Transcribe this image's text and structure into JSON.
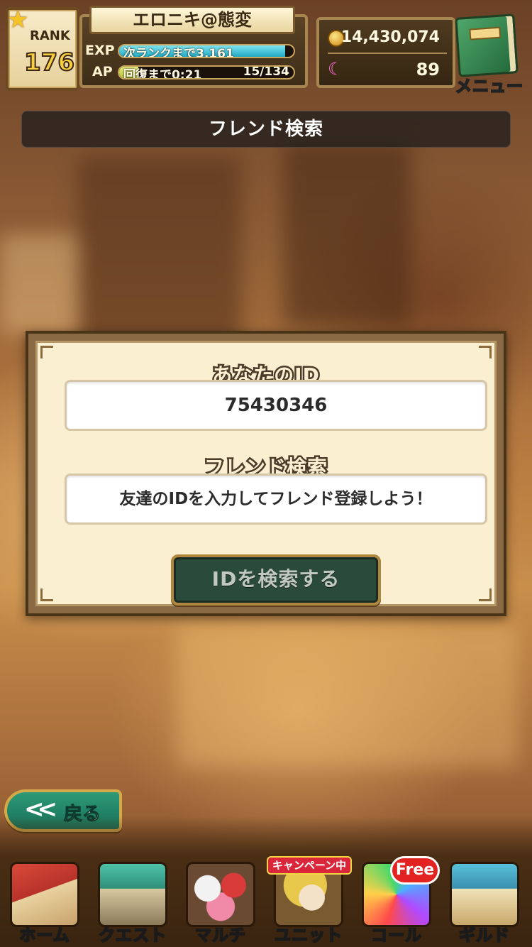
{
  "header": {
    "rank_label": "RANK",
    "rank_value": "176",
    "player_name": "エロニキ@態変",
    "exp_label": "EXP",
    "exp_text": "次ランクまで3,161",
    "exp_fill_fraction": 0.95,
    "ap_label": "AP",
    "ap_text": "回復まで0:21",
    "ap_value": "15/134",
    "ap_fill_fraction": 0.11,
    "coins": "14,430,074",
    "gems": "89",
    "menu_label": "メニュー"
  },
  "page_title": "フレンド検索",
  "dialog": {
    "your_id_label": "あなたのID",
    "your_id_value": "75430346",
    "friend_search_label": "フレンド検索",
    "friend_search_placeholder": "友達のIDを入力してフレンド登録しよう！",
    "search_button_label": "IDを検索する"
  },
  "back_button_label": "戻る",
  "bottom_nav": {
    "items": [
      {
        "label": "ホーム",
        "icon": "house-icon"
      },
      {
        "label": "クエスト",
        "icon": "gate-icon"
      },
      {
        "label": "マルチ",
        "icon": "multi-characters-icon"
      },
      {
        "label": "ユニット",
        "icon": "unit-character-icon"
      },
      {
        "label": "コール",
        "icon": "rainbow-moon-icon"
      },
      {
        "label": "ギルド",
        "icon": "castle-icon"
      }
    ],
    "campaign_badge": "キャンペーン中",
    "free_badge": "Free"
  },
  "colors": {
    "exp_bar": "#3ec6d9",
    "ap_bar": "#c8d84a",
    "dialog_bg": "#fbefd2",
    "search_button": "#2a4a3c",
    "back_button": "#187057"
  }
}
